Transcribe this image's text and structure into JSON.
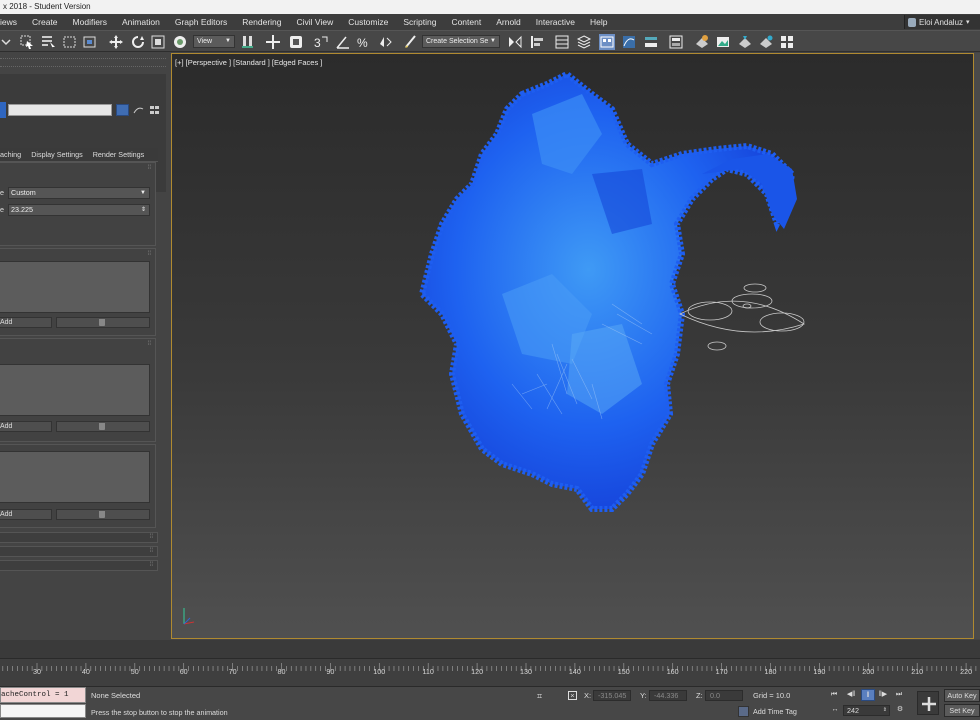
{
  "title_bar": {
    "title": "x 2018 - Student Version"
  },
  "menu": {
    "items": [
      "iews",
      "Create",
      "Modifiers",
      "Animation",
      "Graph Editors",
      "Rendering",
      "Civil View",
      "Customize",
      "Scripting",
      "Content",
      "Arnold",
      "Interactive",
      "Help"
    ],
    "user": "Eloi Andaluz"
  },
  "toolbar": {
    "reference_dropdown": "View",
    "selection_set": "Create Selection Se"
  },
  "command_panel": {
    "tabs": [
      "aching",
      "Display Settings",
      "Render Settings"
    ],
    "type_label": "e",
    "type_value": "Custom",
    "size_label": "e",
    "size_value": "23.225",
    "add_label": "Add",
    "object_color": "#2f66c0"
  },
  "viewport": {
    "label": "[+] [Perspective ] [Standard ] [Edged Faces ]",
    "fluid_color": "#1e5ef0",
    "border_color": "#b08a30"
  },
  "timeline": {
    "ticks": [
      30,
      40,
      50,
      60,
      70,
      80,
      90,
      100,
      110,
      120,
      130,
      140,
      150,
      160,
      170,
      180,
      190,
      200,
      210,
      220
    ]
  },
  "status": {
    "script_text": "acheControl = 1",
    "selection": "None Selected",
    "prompt": "Press the stop button to stop the animation",
    "x_label": "X:",
    "x_value": "-315.045",
    "y_label": "Y:",
    "y_value": "-44.336",
    "z_label": "Z:",
    "z_value": "0.0",
    "grid": "Grid = 10.0",
    "add_time_tag": "Add Time Tag",
    "current_frame": "242",
    "auto_key": "Auto Key",
    "set_key": "Set Key"
  }
}
